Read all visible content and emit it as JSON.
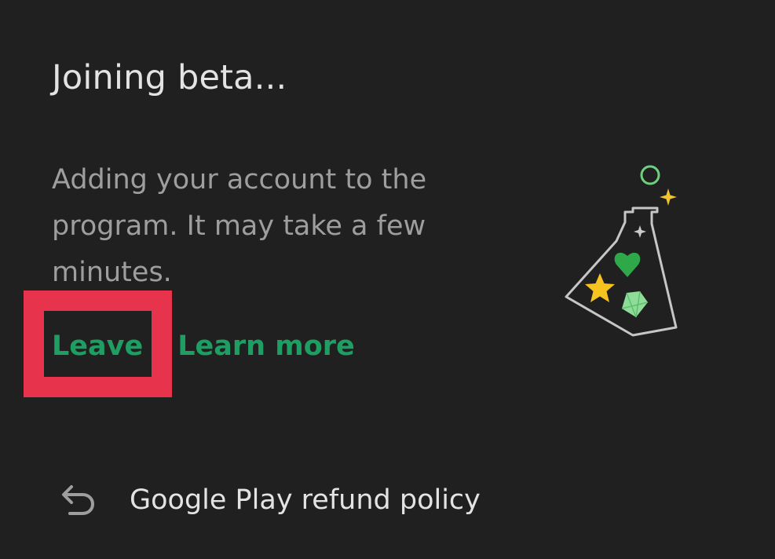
{
  "dialog": {
    "title": "Joining beta...",
    "description": "Adding your account to the program. It may take a few minutes.",
    "actions": {
      "leave_label": "Leave",
      "learn_more_label": "Learn more"
    },
    "illustration_icon": "beta-flask-icon"
  },
  "footer": {
    "refund_icon": "return-arrow-icon",
    "refund_label": "Google Play refund policy"
  },
  "colors": {
    "background": "#202020",
    "title_text": "#e3e3e3",
    "body_text": "#9e9e9e",
    "link_accent": "#1e9e62",
    "annotation_highlight": "#e8334c"
  }
}
